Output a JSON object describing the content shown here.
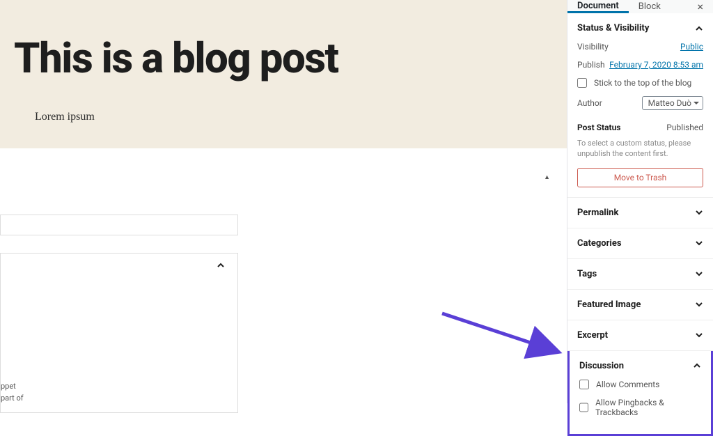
{
  "editor": {
    "title": "This is a blog post",
    "body": "Lorem ipsum",
    "snippet_line1": "ppet",
    "snippet_line2": "part of"
  },
  "tabs": {
    "document": "Document",
    "block": "Block"
  },
  "status": {
    "heading": "Status & Visibility",
    "visibility_label": "Visibility",
    "visibility_value": "Public",
    "publish_label": "Publish",
    "publish_value": "February 7, 2020 8:53 am",
    "sticky": "Stick to the top of the blog",
    "author_label": "Author",
    "author_value": "Matteo Duò",
    "post_status_label": "Post Status",
    "post_status_value": "Published",
    "note": "To select a custom status, please unpublish the content first.",
    "trash": "Move to Trash"
  },
  "panels": {
    "permalink": "Permalink",
    "categories": "Categories",
    "tags": "Tags",
    "featured": "Featured Image",
    "excerpt": "Excerpt",
    "discussion": "Discussion"
  },
  "discussion": {
    "allow_comments": "Allow Comments",
    "allow_pings": "Allow Pingbacks & Trackbacks"
  }
}
